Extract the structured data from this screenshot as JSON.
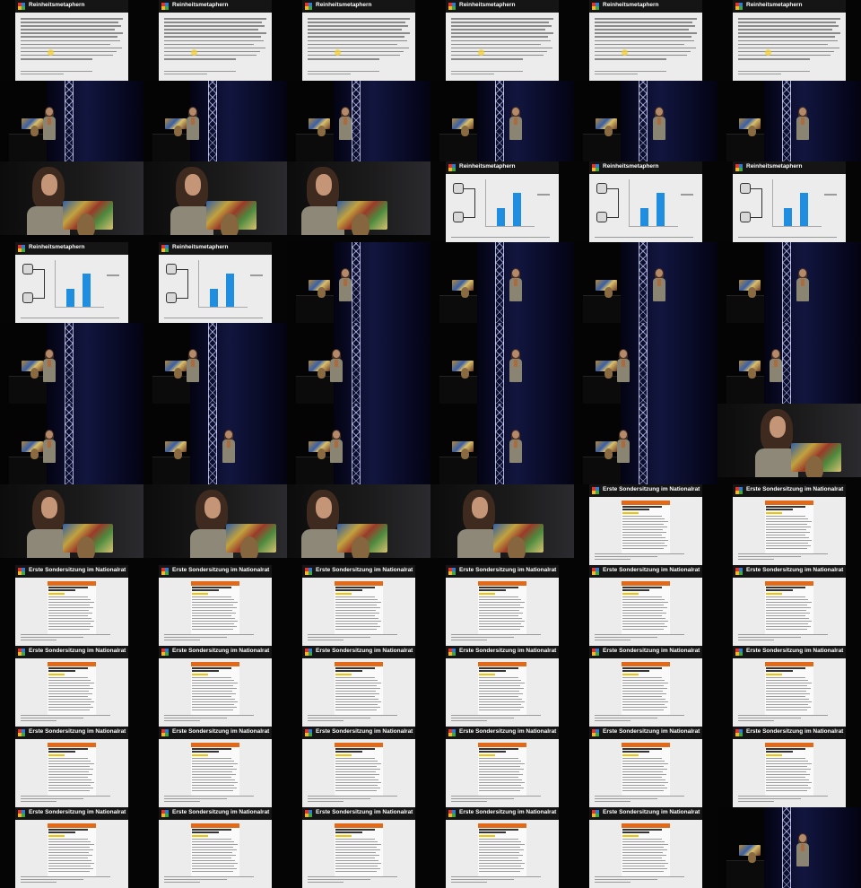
{
  "frames": [
    {
      "kind": "text",
      "title": "Reinheitsmetaphern"
    },
    {
      "kind": "text",
      "title": "Reinheitsmetaphern"
    },
    {
      "kind": "text",
      "title": "Reinheitsmetaphern"
    },
    {
      "kind": "text",
      "title": "Reinheitsmetaphern"
    },
    {
      "kind": "text",
      "title": "Reinheitsmetaphern"
    },
    {
      "kind": "text",
      "title": "Reinheitsmetaphern"
    },
    {
      "kind": "stage",
      "pose": "podium"
    },
    {
      "kind": "stage",
      "pose": "podium"
    },
    {
      "kind": "stage",
      "pose": "podium-gesture"
    },
    {
      "kind": "stage",
      "pose": "standing"
    },
    {
      "kind": "stage",
      "pose": "standing"
    },
    {
      "kind": "stage",
      "pose": "standing"
    },
    {
      "kind": "close",
      "pose": "face-left"
    },
    {
      "kind": "close",
      "pose": "face-left"
    },
    {
      "kind": "close",
      "pose": "hand-face"
    },
    {
      "kind": "chart",
      "title": "Reinheitsmetaphern"
    },
    {
      "kind": "chart",
      "title": "Reinheitsmetaphern"
    },
    {
      "kind": "chart",
      "title": "Reinheitsmetaphern"
    },
    {
      "kind": "chart",
      "title": "Reinheitsmetaphern"
    },
    {
      "kind": "chart",
      "title": "Reinheitsmetaphern"
    },
    {
      "kind": "stage",
      "pose": "podium-gesture"
    },
    {
      "kind": "stage",
      "pose": "standing"
    },
    {
      "kind": "stage",
      "pose": "standing"
    },
    {
      "kind": "stage",
      "pose": "standing"
    },
    {
      "kind": "stage",
      "pose": "podium"
    },
    {
      "kind": "stage",
      "pose": "podium"
    },
    {
      "kind": "stage",
      "pose": "podium"
    },
    {
      "kind": "stage",
      "pose": "standing"
    },
    {
      "kind": "stage",
      "pose": "podium"
    },
    {
      "kind": "stage",
      "pose": "podium-gesture"
    },
    {
      "kind": "stage",
      "pose": "podium"
    },
    {
      "kind": "stage",
      "pose": "standing"
    },
    {
      "kind": "stage",
      "pose": "podium"
    },
    {
      "kind": "stage",
      "pose": "standing"
    },
    {
      "kind": "stage",
      "pose": "podium"
    },
    {
      "kind": "close",
      "pose": "side"
    },
    {
      "kind": "close",
      "pose": "face-left"
    },
    {
      "kind": "close",
      "pose": "face-center"
    },
    {
      "kind": "close",
      "pose": "hand-face"
    },
    {
      "kind": "close",
      "pose": "face-left"
    },
    {
      "kind": "news",
      "title": "Erste Sondersitzung im Nationalrat"
    },
    {
      "kind": "news",
      "title": "Erste Sondersitzung im Nationalrat"
    },
    {
      "kind": "news",
      "title": "Erste Sondersitzung im Nationalrat"
    },
    {
      "kind": "news",
      "title": "Erste Sondersitzung im Nationalrat"
    },
    {
      "kind": "news",
      "title": "Erste Sondersitzung im Nationalrat"
    },
    {
      "kind": "news",
      "title": "Erste Sondersitzung im Nationalrat"
    },
    {
      "kind": "news",
      "title": "Erste Sondersitzung im Nationalrat"
    },
    {
      "kind": "news",
      "title": "Erste Sondersitzung im Nationalrat"
    },
    {
      "kind": "news",
      "title": "Erste Sondersitzung im Nationalrat"
    },
    {
      "kind": "news",
      "title": "Erste Sondersitzung im Nationalrat"
    },
    {
      "kind": "news",
      "title": "Erste Sondersitzung im Nationalrat"
    },
    {
      "kind": "news",
      "title": "Erste Sondersitzung im Nationalrat"
    },
    {
      "kind": "news",
      "title": "Erste Sondersitzung im Nationalrat"
    },
    {
      "kind": "news",
      "title": "Erste Sondersitzung im Nationalrat"
    },
    {
      "kind": "news",
      "title": "Erste Sondersitzung im Nationalrat"
    },
    {
      "kind": "news",
      "title": "Erste Sondersitzung im Nationalrat"
    },
    {
      "kind": "news",
      "title": "Erste Sondersitzung im Nationalrat"
    },
    {
      "kind": "news",
      "title": "Erste Sondersitzung im Nationalrat"
    },
    {
      "kind": "news",
      "title": "Erste Sondersitzung im Nationalrat"
    },
    {
      "kind": "news",
      "title": "Erste Sondersitzung im Nationalrat"
    },
    {
      "kind": "news",
      "title": "Erste Sondersitzung im Nationalrat"
    },
    {
      "kind": "news",
      "title": "Erste Sondersitzung im Nationalrat"
    },
    {
      "kind": "news",
      "title": "Erste Sondersitzung im Nationalrat"
    },
    {
      "kind": "news",
      "title": "Erste Sondersitzung im Nationalrat"
    },
    {
      "kind": "news",
      "title": "Erste Sondersitzung im Nationalrat"
    },
    {
      "kind": "stage",
      "pose": "standing"
    }
  ],
  "colors": {
    "slide_bg": "#ececec",
    "slide_header": "#151515",
    "chart_bar": "#1f8de0",
    "news_accent": "#e06a1a",
    "highlight": "#f2c300",
    "curtain": "#12163f"
  }
}
